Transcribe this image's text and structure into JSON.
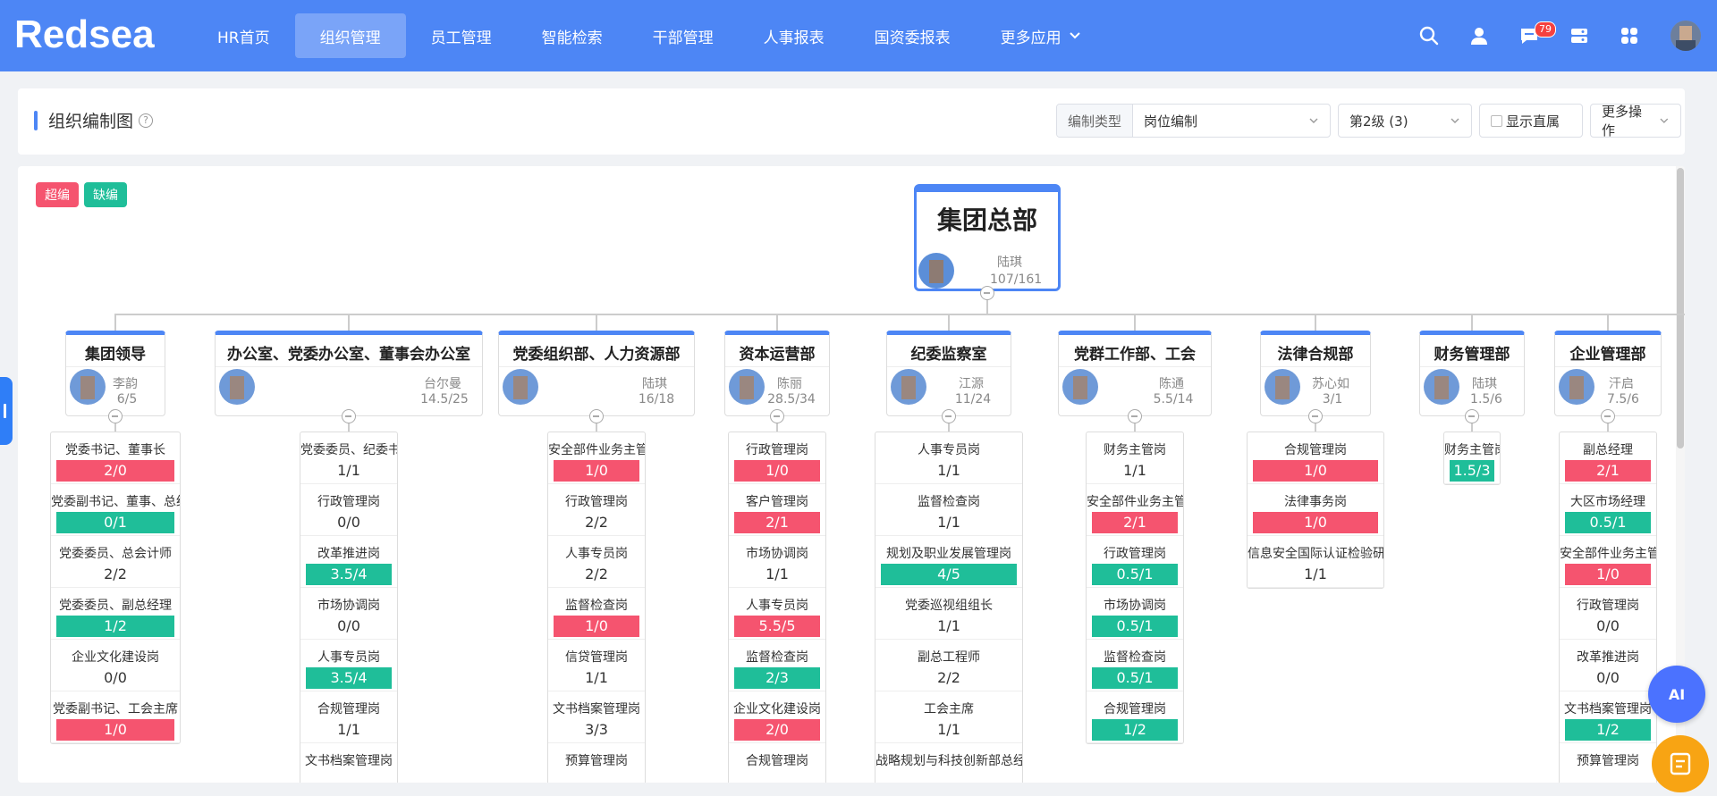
{
  "app": {
    "logo_text": "Redsea",
    "accent": "#4d86f5"
  },
  "nav": [
    {
      "label": "HR首页",
      "active": false
    },
    {
      "label": "组织管理",
      "active": true
    },
    {
      "label": "员工管理",
      "active": false
    },
    {
      "label": "智能检索",
      "active": false
    },
    {
      "label": "干部管理",
      "active": false
    },
    {
      "label": "人事报表",
      "active": false
    },
    {
      "label": "国资委报表",
      "active": false
    },
    {
      "label": "更多应用",
      "active": false
    }
  ],
  "top_icons": {
    "search": "search-icon",
    "user": "user-icon",
    "message": "message-icon",
    "message_badge": "79",
    "server": "server-icon",
    "apps": "apps-icon"
  },
  "header": {
    "title": "组织编制图",
    "help": "?",
    "type_label": "编制类型",
    "type_value": "岗位编制",
    "level_value": "第2级 (3)",
    "direct_label": "显示直属",
    "more_label": "更多操作"
  },
  "legend": {
    "over": "超编",
    "short": "缺编",
    "over_color": "#f5546f",
    "short_color": "#1fbe99"
  },
  "root": {
    "name": "集团总部",
    "manager": "陆琪",
    "count": "107/161"
  },
  "departments": [
    {
      "name": "集团领导",
      "manager": "李韵",
      "count": "6/5",
      "positions": [
        {
          "name": "党委书记、董事长",
          "value": "2/0",
          "status": "over"
        },
        {
          "name": "党委副书记、董事、总经理",
          "value": "0/1",
          "status": "short"
        },
        {
          "name": "党委委员、总会计师",
          "value": "2/2",
          "status": "normal"
        },
        {
          "name": "党委委员、副总经理",
          "value": "1/2",
          "status": "short"
        },
        {
          "name": "企业文化建设岗",
          "value": "0/0",
          "status": "normal"
        },
        {
          "name": "党委副书记、工会主席",
          "value": "1/0",
          "status": "over"
        }
      ]
    },
    {
      "name": "办公室、党委办公室、董事会办公室",
      "manager": "台尔曼",
      "count": "14.5/25",
      "positions": [
        {
          "name": "党委委员、纪委书记",
          "value": "1/1",
          "status": "normal"
        },
        {
          "name": "行政管理岗",
          "value": "0/0",
          "status": "normal"
        },
        {
          "name": "改革推进岗",
          "value": "3.5/4",
          "status": "short"
        },
        {
          "name": "市场协调岗",
          "value": "0/0",
          "status": "normal"
        },
        {
          "name": "人事专员岗",
          "value": "3.5/4",
          "status": "short"
        },
        {
          "name": "合规管理岗",
          "value": "1/1",
          "status": "normal"
        },
        {
          "name": "文书档案管理岗",
          "value": "",
          "status": "normal"
        }
      ]
    },
    {
      "name": "党委组织部、人力资源部",
      "manager": "陆琪",
      "count": "16/18",
      "positions": [
        {
          "name": "安全部件业务主管岗",
          "value": "1/0",
          "status": "over"
        },
        {
          "name": "行政管理岗",
          "value": "2/2",
          "status": "normal"
        },
        {
          "name": "人事专员岗",
          "value": "2/2",
          "status": "normal"
        },
        {
          "name": "监督检查岗",
          "value": "1/0",
          "status": "over"
        },
        {
          "name": "信贷管理岗",
          "value": "1/1",
          "status": "normal"
        },
        {
          "name": "文书档案管理岗",
          "value": "3/3",
          "status": "normal"
        },
        {
          "name": "预算管理岗",
          "value": "",
          "status": "normal"
        }
      ]
    },
    {
      "name": "资本运营部",
      "manager": "陈丽",
      "count": "28.5/34",
      "positions": [
        {
          "name": "行政管理岗",
          "value": "1/0",
          "status": "over"
        },
        {
          "name": "客户管理岗",
          "value": "2/1",
          "status": "over"
        },
        {
          "name": "市场协调岗",
          "value": "1/1",
          "status": "normal"
        },
        {
          "name": "人事专员岗",
          "value": "5.5/5",
          "status": "over"
        },
        {
          "name": "监督检查岗",
          "value": "2/3",
          "status": "short"
        },
        {
          "name": "企业文化建设岗",
          "value": "2/0",
          "status": "over"
        },
        {
          "name": "合规管理岗",
          "value": "",
          "status": "normal"
        }
      ]
    },
    {
      "name": "纪委监察室",
      "manager": "江源",
      "count": "11/24",
      "positions": [
        {
          "name": "人事专员岗",
          "value": "1/1",
          "status": "normal"
        },
        {
          "name": "监督检查岗",
          "value": "1/1",
          "status": "normal"
        },
        {
          "name": "规划及职业发展管理岗",
          "value": "4/5",
          "status": "short"
        },
        {
          "name": "党委巡视组组长",
          "value": "1/1",
          "status": "normal"
        },
        {
          "name": "副总工程师",
          "value": "2/2",
          "status": "normal"
        },
        {
          "name": "工会主席",
          "value": "1/1",
          "status": "normal"
        },
        {
          "name": "战略规划与科技创新部总经理岗",
          "value": "",
          "status": "normal"
        }
      ]
    },
    {
      "name": "党群工作部、工会",
      "manager": "陈通",
      "count": "5.5/14",
      "positions": [
        {
          "name": "财务主管岗",
          "value": "1/1",
          "status": "normal"
        },
        {
          "name": "安全部件业务主管岗",
          "value": "2/1",
          "status": "over"
        },
        {
          "name": "行政管理岗",
          "value": "0.5/1",
          "status": "short"
        },
        {
          "name": "市场协调岗",
          "value": "0.5/1",
          "status": "short"
        },
        {
          "name": "监督检查岗",
          "value": "0.5/1",
          "status": "short"
        },
        {
          "name": "合规管理岗",
          "value": "1/2",
          "status": "short"
        }
      ]
    },
    {
      "name": "法律合规部",
      "manager": "苏心如",
      "count": "3/1",
      "positions": [
        {
          "name": "合规管理岗",
          "value": "1/0",
          "status": "over"
        },
        {
          "name": "法律事务岗",
          "value": "1/0",
          "status": "over"
        },
        {
          "name": "信息安全国际认证检验研究岗",
          "value": "1/1",
          "status": "normal"
        }
      ]
    },
    {
      "name": "财务管理部",
      "manager": "陆琪",
      "count": "1.5/6",
      "positions": [
        {
          "name": "财务主管岗",
          "value": "1.5/3",
          "status": "short"
        }
      ]
    },
    {
      "name": "企业管理部",
      "manager": "汗启",
      "count": "7.5/6",
      "positions": [
        {
          "name": "副总经理",
          "value": "2/1",
          "status": "over"
        },
        {
          "name": "大区市场经理",
          "value": "0.5/1",
          "status": "short"
        },
        {
          "name": "安全部件业务主管岗",
          "value": "1/0",
          "status": "over"
        },
        {
          "name": "行政管理岗",
          "value": "0/0",
          "status": "normal"
        },
        {
          "name": "改革推进岗",
          "value": "0/0",
          "status": "normal"
        },
        {
          "name": "文书档案管理岗",
          "value": "1/2",
          "status": "short"
        },
        {
          "name": "预算管理岗",
          "value": "",
          "status": "normal"
        }
      ]
    }
  ],
  "floating": {
    "ai_label": "AI",
    "ai_icon": "ai-assistant-icon",
    "fab_icon": "notebook-icon"
  }
}
